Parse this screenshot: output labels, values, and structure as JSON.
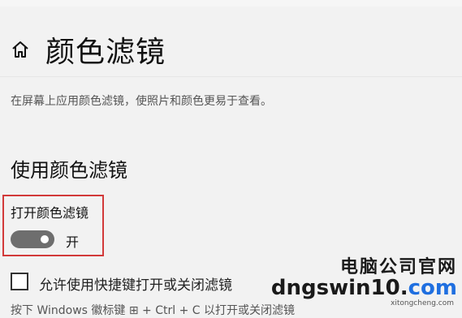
{
  "header": {
    "title": "颜色滤镜"
  },
  "description": "在屏幕上应用颜色滤镜，使照片和颜色更易于查看。",
  "section": {
    "title": "使用颜色滤镜"
  },
  "toggle": {
    "label": "打开颜色滤镜",
    "state": "开",
    "on": true
  },
  "shortcut_checkbox": {
    "label": "允许使用快捷键打开或关闭滤镜",
    "checked": false
  },
  "bottom_hint": "按下 Windows 徽标键 ⊞ + Ctrl + C 以打开或关闭滤镜",
  "watermark": {
    "line1": "电脑公司官网",
    "line2_prefix": "dngswin10.",
    "line2_accent": "com",
    "line2_suffix": "",
    "sub": "xitongcheng.com"
  },
  "colors": {
    "highlight_border": "#d23a3a",
    "toggle_on": "#6e6e6e",
    "background": "#f2f2f2"
  }
}
